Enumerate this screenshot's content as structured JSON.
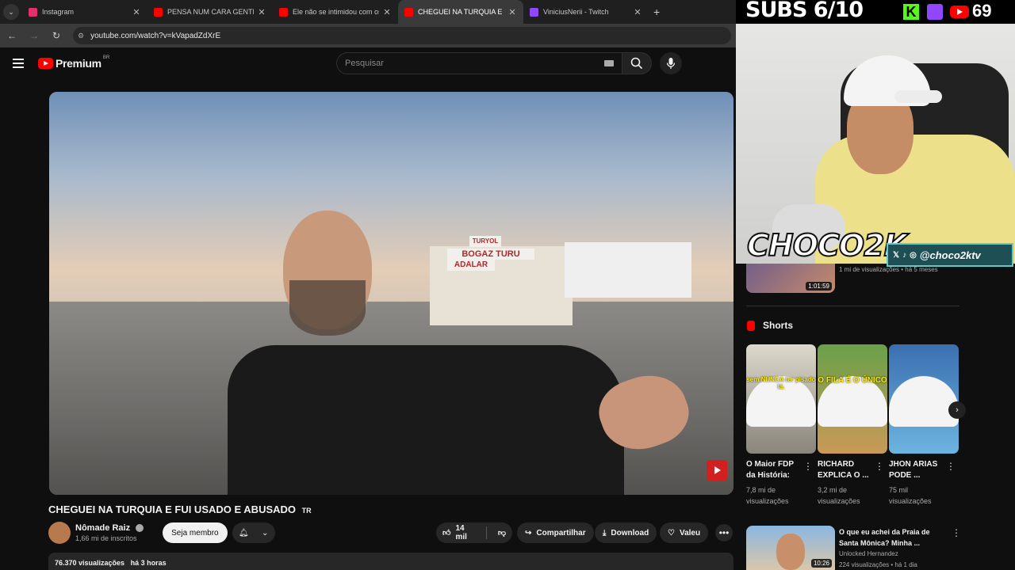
{
  "browser": {
    "tabs": [
      {
        "title": "Instagram",
        "color": "#e1306c",
        "active": false
      },
      {
        "title": "PENSA NUM CARA GENTE BOA",
        "color": "#ff0000",
        "active": false
      },
      {
        "title": "Ele não se intimidou com os p",
        "color": "#ff0000",
        "active": false
      },
      {
        "title": "CHEGUEI NA TURQUIA E FUI U",
        "color": "#ff0000",
        "active": true
      },
      {
        "title": "ViniciusNerii - Twitch",
        "color": "#9146ff",
        "active": false
      }
    ],
    "url": "youtube.com/watch?v=kVapadZdXrE"
  },
  "yt": {
    "logo_text": "Premium",
    "logo_region": "BR",
    "search_placeholder": "Pesquisar"
  },
  "video": {
    "title": "CHEGUEI NA TURQUIA E FUI USADO E ABUSADO",
    "title_badge": "TR",
    "channel": "Nômade Raiz",
    "subscribers": "1,66 mi de inscritos",
    "member_button": "Seja membro",
    "likes": "14 mil",
    "share": "Compartilhar",
    "download": "Download",
    "thanks": "Valeu",
    "views": "76.370 visualizações",
    "uploaded": "há 3 horas",
    "scene_signs": [
      "BOGAZ TURU",
      "ADALAR",
      "TURYOL"
    ]
  },
  "sidebar": {
    "top_video": {
      "duration": "1:01:59",
      "meta": "1 mi de visualizações • há 5 meses"
    },
    "shorts_title": "Shorts",
    "shorts": [
      {
        "title": "O Maior FDP da História:",
        "views": "7,8 mi de visualizações",
        "caption": "sem NUNCA ter pisado lá."
      },
      {
        "title": "RICHARD EXPLICA O ...",
        "views": "3,2 mi de visualizações",
        "caption": "O FILA É O ÚNICO"
      },
      {
        "title": "JHON ARIAS PODE ...",
        "views": "75 mil visualizações",
        "caption": ""
      }
    ],
    "related": {
      "title": "O que eu achei da Praia de Santa Mônica? Minha ...",
      "channel": "Unlocked Hernandez",
      "meta": "224 visualizações • há 1 dia",
      "duration": "10:26"
    }
  },
  "stream_overlay": {
    "subs_goal": "SUBS 6/10",
    "kick_letter": "K",
    "sub_count": "69",
    "brand": "CHOCO2K",
    "handle": "@choco2ktv"
  }
}
